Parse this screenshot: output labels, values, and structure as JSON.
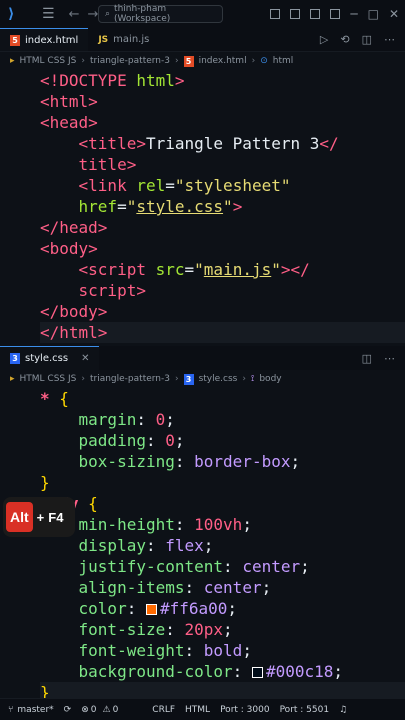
{
  "titlebar": {
    "workspace": "thinh-pham (Workspace)"
  },
  "editor1": {
    "tabs": [
      {
        "label": "index.html",
        "icon": "html-icon",
        "active": true
      },
      {
        "label": "main.js",
        "icon": "js-icon",
        "active": false
      }
    ],
    "breadcrumb": [
      "HTML CSS JS",
      "triangle-pattern-3",
      "index.html",
      "html"
    ],
    "lines": [
      "<!DOCTYPE html>",
      "<html>",
      "<head>",
      "    <title>Triangle Pattern 3</",
      "    title>",
      "    <link rel=\"stylesheet\"",
      "    href=\"style.css\">",
      "</head>",
      "<body>",
      "    <script src=\"main.js\"></",
      "    script>",
      "</body>",
      "</html>"
    ]
  },
  "editor2": {
    "tab": {
      "label": "style.css",
      "icon": "css-icon"
    },
    "breadcrumb": [
      "HTML CSS JS",
      "triangle-pattern-3",
      "style.css",
      "body"
    ],
    "lines": [
      "* {",
      "    margin: 0;",
      "    padding: 0;",
      "    box-sizing: border-box;",
      "}",
      "body {",
      "    min-height: 100vh;",
      "    display: flex;",
      "    justify-content: center;",
      "    align-items: center;",
      "    color: #ff6a00;",
      "    font-size: 20px;",
      "    font-weight: bold;",
      "    background-color: #000c18;",
      "}"
    ],
    "colors": {
      "color_swatch": "#ff6a00",
      "bg_swatch": "#000c18"
    }
  },
  "overlay": {
    "key1": "Alt",
    "plus": "+",
    "key2": "F4"
  },
  "statusbar": {
    "branch": "master*",
    "errors": "0",
    "warnings": "0",
    "eol": "CRLF",
    "language": "HTML",
    "port1": "Port : 3000",
    "port2": "Port : 5501"
  }
}
